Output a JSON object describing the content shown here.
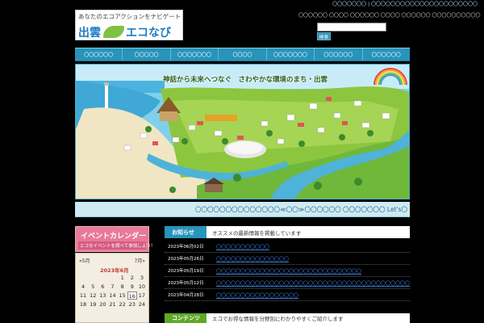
{
  "header": {
    "top_links": "〇〇〇〇〇〇〇 | 〇〇〇〇〇〇〇〇〇〇〇〇〇〇〇〇〇〇〇〇〇〇",
    "logo_tagline": "あなたのエコアクションをナビゲート",
    "logo_izumo": "出雲",
    "logo_eco": "エコなび",
    "links": "〇〇〇〇〇〇 〇〇〇〇 〇〇〇〇〇〇 〇〇〇〇 〇〇〇〇〇〇 〇〇〇〇〇〇〇〇〇〇",
    "search_value": "",
    "search_button": "検索"
  },
  "nav": {
    "items": [
      "〇〇〇〇〇〇",
      "〇〇〇〇〇",
      "〇〇〇〇〇〇〇",
      "〇〇〇〇",
      "〇〇〇〇〇〇〇",
      "〇〇〇〇〇〇",
      "〇〇〇〇〇〇"
    ]
  },
  "hero": {
    "caption": "神話から未来へつなぐ　さわやかな環境のまち・出雲"
  },
  "ticker": {
    "text": "〇〇〇〇〇〇〇〇〇〇〇〇〇〇≪〇〇≫〇〇〇〇〇〇 〇〇〇〇〇〇〇 Let's〇"
  },
  "sidebar": {
    "event_title": "イベントカレンダー",
    "event_sub": "エコなイベントを調べて参加しよう！",
    "calendar": {
      "prev": "«5月",
      "next": "7月»",
      "month": "2023年6月",
      "days": [
        "",
        "",
        "",
        "",
        "1",
        "2",
        "3",
        "4",
        "5",
        "6",
        "7",
        "8",
        "9",
        "10",
        "11",
        "12",
        "13",
        "14",
        "15",
        "16",
        "17",
        "18",
        "19",
        "20",
        "21",
        "22",
        "23",
        "24"
      ],
      "today": "16"
    }
  },
  "news": {
    "label": "お知らせ",
    "description": "オススメの最新情報を掲載しています",
    "items": [
      {
        "date": "2023年06月02日",
        "title": "〇〇〇〇〇〇〇〇〇〇〇"
      },
      {
        "date": "2023年05月26日",
        "title": "〇〇〇〇〇〇〇〇〇〇〇〇〇〇〇"
      },
      {
        "date": "2023年05月19日",
        "title": "〇〇〇〇〇〇〇〇〇〇〇〇〇〇〇〇〇〇〇〇〇〇〇〇〇〇〇〇〇〇"
      },
      {
        "date": "2023年05月12日",
        "title": "〇〇〇〇〇〇〇〇〇〇〇〇〇〇〇〇〇〇〇〇〇〇〇〇〇〇〇〇〇〇〇〇〇〇〇〇〇〇〇〇"
      },
      {
        "date": "2023年04月28日",
        "title": "〇〇〇〇〇〇〇〇〇〇〇〇〇〇〇〇〇"
      }
    ]
  },
  "contents": {
    "label": "コンテンツ",
    "description": "エコでお得な情報を分野別にわかりやすくご紹介します"
  },
  "colors": {
    "nav": "#2894ba",
    "event": "#e87a9a",
    "contents": "#5fa826"
  }
}
